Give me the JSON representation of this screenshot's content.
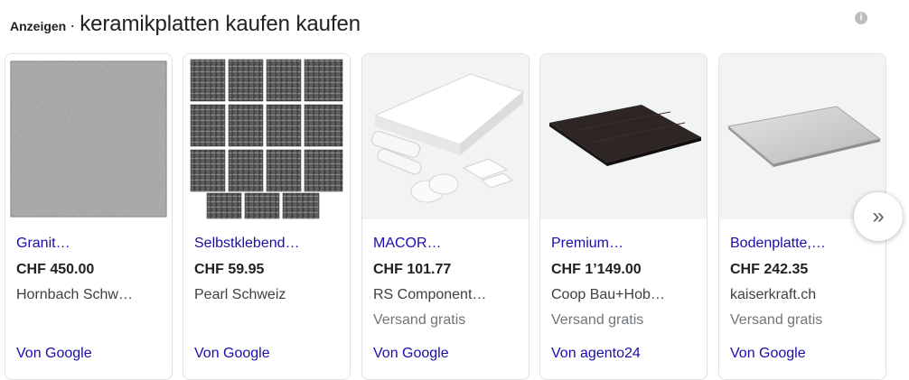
{
  "header": {
    "ads_label": "Anzeigen",
    "separator": "·",
    "query": "keramikplatten kaufen kaufen",
    "info_icon": "i"
  },
  "products": [
    {
      "image_icon": "granite-tile-image",
      "title": "Granit…",
      "price": "CHF 450.00",
      "merchant": "Hornbach Schw…",
      "shipping": "",
      "source": "Von Google"
    },
    {
      "image_icon": "mosaic-tiles-image",
      "title": "Selbstklebend…",
      "price": "CHF 59.95",
      "merchant": "Pearl Schweiz",
      "shipping": "",
      "source": "Von Google"
    },
    {
      "image_icon": "macor-ceramic-image",
      "title": "MACOR…",
      "price": "CHF 101.77",
      "merchant": "RS Component…",
      "shipping": "Versand gratis",
      "source": "Von Google"
    },
    {
      "image_icon": "dark-panel-image",
      "title": "Premium…",
      "price": "CHF 1’149.00",
      "merchant": "Coop Bau+Hob…",
      "shipping": "Versand gratis",
      "source": "Von agento24"
    },
    {
      "image_icon": "floor-plate-image",
      "title": "Bodenplatte,…",
      "price": "CHF 242.35",
      "merchant": "kaiserkraft.ch",
      "shipping": "Versand gratis",
      "source": "Von Google"
    }
  ],
  "carousel": {
    "next_icon": "»"
  }
}
